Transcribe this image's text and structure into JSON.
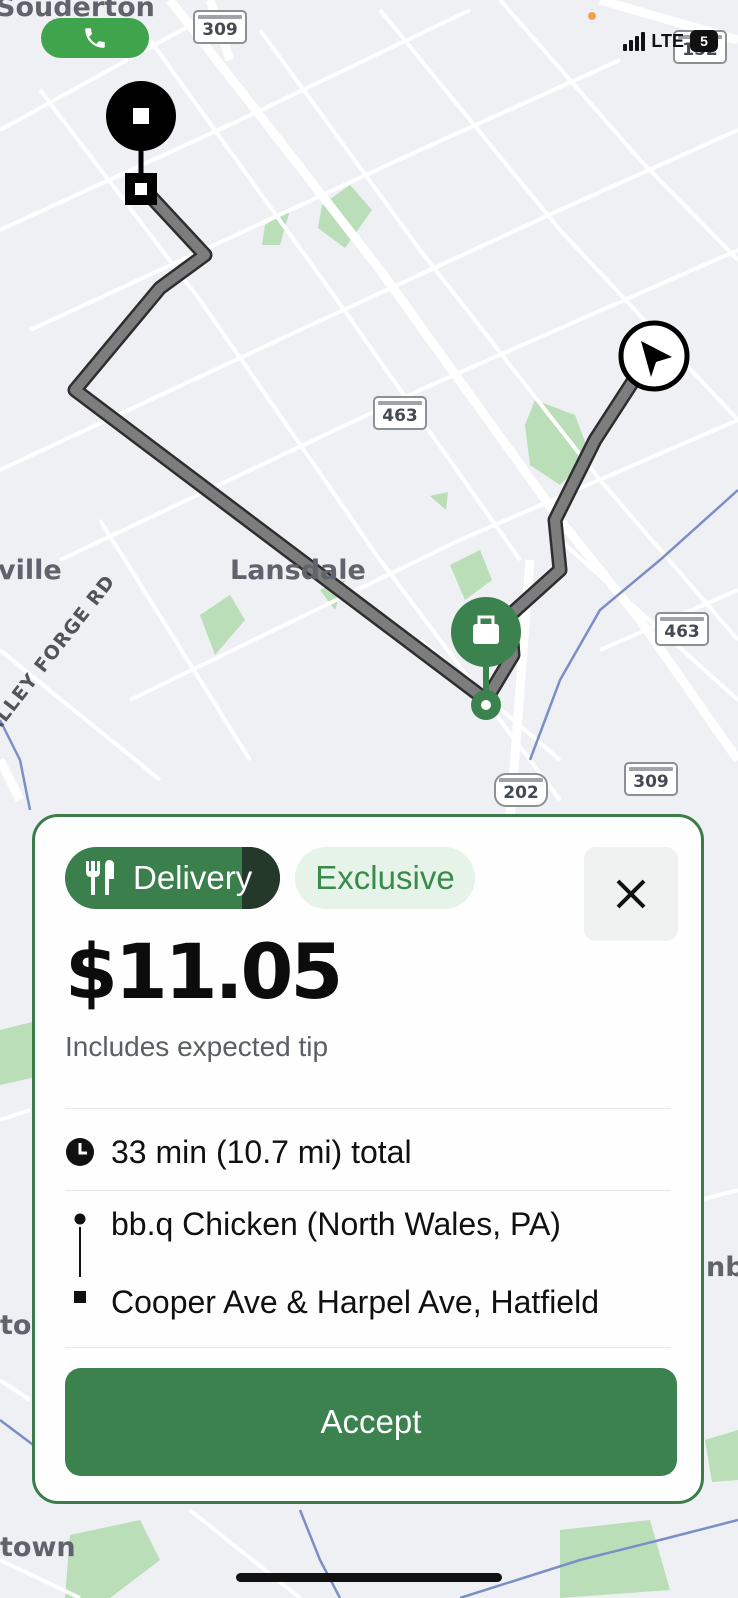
{
  "map": {
    "places": {
      "souderton": "Souderton",
      "lansdale": "Lansdale",
      "ville": "ville",
      "valley_forge_rd": "ALLEY FORGE RD",
      "town": "town",
      "to": "to",
      "nb": "nb"
    },
    "shields": {
      "r309_top": "309",
      "r152": "152",
      "r463_center": "463",
      "r463_right": "463",
      "r202": "202",
      "r309_bottom": "309"
    }
  },
  "status_bar": {
    "network": "LTE",
    "battery": "5"
  },
  "offer": {
    "tags": {
      "delivery": "Delivery",
      "exclusive": "Exclusive"
    },
    "price": "$11.05",
    "price_note": "Includes expected tip",
    "duration": "33 min (10.7 mi) total",
    "pickup": "bb.q Chicken (North Wales, PA)",
    "dropoff": "Cooper Ave & Harpel Ave, Hatfield",
    "accept_label": "Accept"
  },
  "icons": {
    "phone": "phone-icon",
    "utensils": "utensils-icon",
    "close": "close-icon",
    "clock": "clock-icon",
    "bag": "bag-icon",
    "navigation": "navigation-arrow-icon"
  },
  "colors": {
    "brand_green": "#3b824f",
    "route": "#6b6b6b",
    "exclusive_bg": "#e6f3e8"
  }
}
